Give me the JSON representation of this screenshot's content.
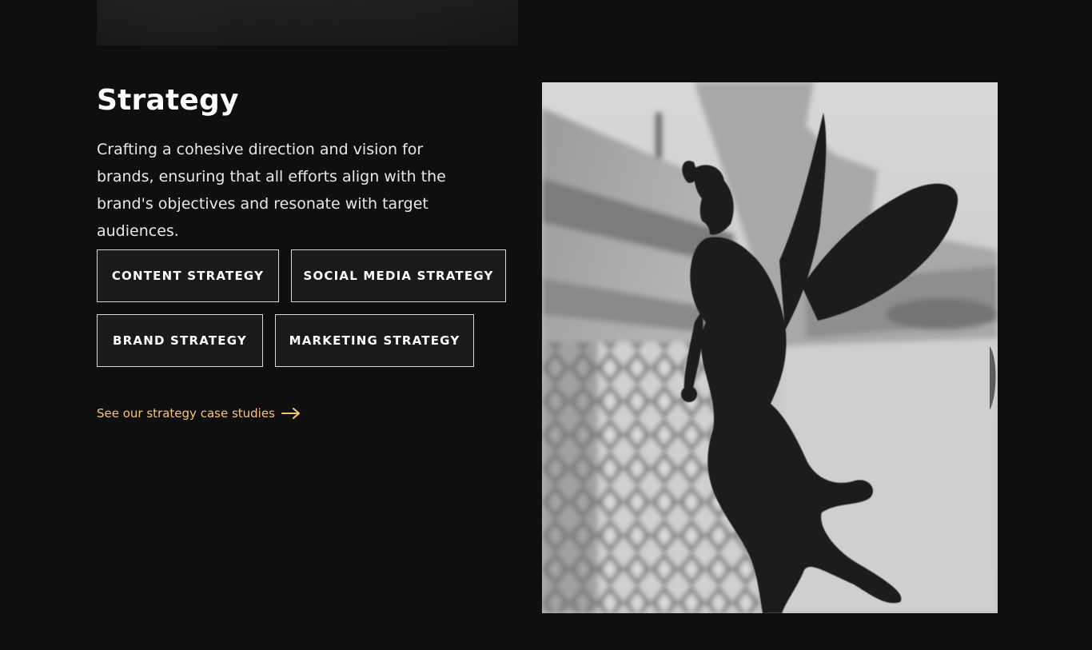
{
  "section": {
    "title": "Strategy",
    "description": "Crafting a cohesive direction and vision for brands, ensuring that all efforts align with the brand's objectives and resonate with target audiences."
  },
  "tags": {
    "row1": [
      {
        "label": "CONTENT STRATEGY"
      },
      {
        "label": "SOCIAL MEDIA STRATEGY"
      }
    ],
    "row2": [
      {
        "label": "BRAND STRATEGY"
      },
      {
        "label": "MARKETING STRATEGY"
      }
    ]
  },
  "cta": {
    "label": "See our strategy case studies",
    "icon": "arrow-right-icon"
  },
  "colors": {
    "background": "#0f0f0f",
    "accent": "#f4c67d",
    "tag_border": "#d9d9d9",
    "tag_background": "#1a1a1a"
  },
  "images": {
    "top_image": "dark-textured-image",
    "hero_image": "angel-statue-photo"
  }
}
